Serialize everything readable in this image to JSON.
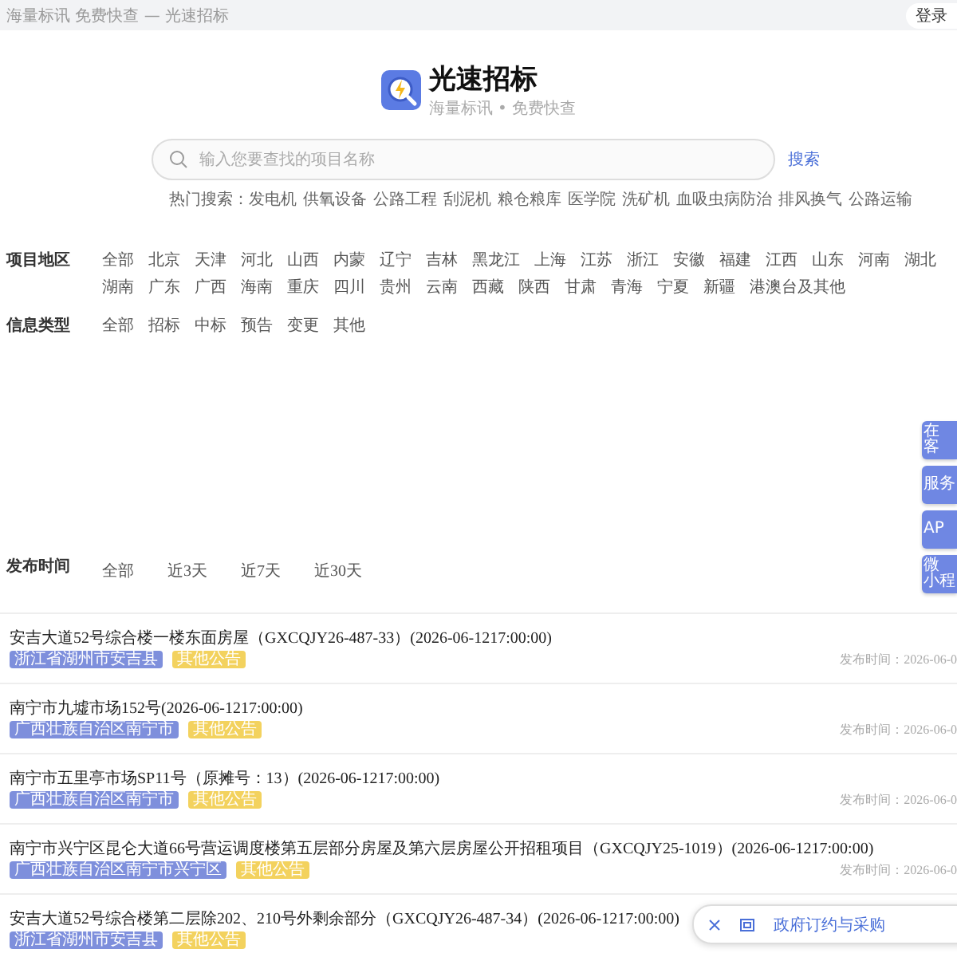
{
  "top_bar": {
    "title": "海量标讯 免费快查 — 光速招标",
    "login": "登录"
  },
  "brand": {
    "name": "光速招标",
    "slogan": "海量标讯 • 免费快查"
  },
  "search": {
    "placeholder": "输入您要查找的项目名称",
    "button": "搜索"
  },
  "hot_search": {
    "label": "热门搜索：",
    "items": [
      "发电机",
      "供氧设备",
      "公路工程",
      "刮泥机",
      "粮仓粮库",
      "医学院",
      "洗矿机",
      "血吸虫病防治",
      "排风换气",
      "公路运输"
    ]
  },
  "filters": [
    {
      "label": "项目地区",
      "options": [
        "全部",
        "北京",
        "天津",
        "河北",
        "山西",
        "内蒙",
        "辽宁",
        "吉林",
        "黑龙江",
        "上海",
        "江苏",
        "浙江",
        "安徽",
        "福建",
        "江西",
        "山东",
        "河南",
        "湖北",
        "湖南",
        "广东",
        "广西",
        "海南",
        "重庆",
        "四川",
        "贵州",
        "云南",
        "西藏",
        "陕西",
        "甘肃",
        "青海",
        "宁夏",
        "新疆",
        "港澳台及其他"
      ]
    },
    {
      "label": "信息类型",
      "options": [
        "全部",
        "招标",
        "中标",
        "预告",
        "变更",
        "其他"
      ]
    }
  ],
  "time_filter": {
    "label": "发布时间",
    "options": [
      "全部",
      "近3天",
      "近7天",
      "近30天"
    ]
  },
  "side_buttons": [
    [
      "在",
      "客"
    ],
    [
      "服务"
    ],
    [
      "AP"
    ],
    [
      "微",
      "小程"
    ]
  ],
  "results": [
    {
      "title": "安吉大道52号综合楼一楼东面房屋（GXCQJY26-487-33）(2026-06-1217:00:00)",
      "region": "浙江省湖州市安吉县",
      "type": "其他公告",
      "date": "发布时间：2026-06-0"
    },
    {
      "title": "南宁市九墟市场152号(2026-06-1217:00:00)",
      "region": "广西壮族自治区南宁市",
      "type": "其他公告",
      "date": "发布时间：2026-06-0"
    },
    {
      "title": "南宁市五里亭市场SP11号（原摊号：13）(2026-06-1217:00:00)",
      "region": "广西壮族自治区南宁市",
      "type": "其他公告",
      "date": "发布时间：2026-06-0"
    },
    {
      "title": "南宁市兴宁区昆仑大道66号营运调度楼第五层部分房屋及第六层房屋公开招租项目（GXCQJY25-1019）(2026-06-1217:00:00)",
      "region": "广西壮族自治区南宁市兴宁区",
      "type": "其他公告",
      "date": "发布时间：2026-06-0"
    },
    {
      "title": "安吉大道52号综合楼第二层除202、210号外剩余部分（GXCQJY26-487-34）(2026-06-1217:00:00)",
      "region": "浙江省湖州市安吉县",
      "type": "其他公告"
    }
  ],
  "popup": {
    "label": "政府订约与采购"
  }
}
